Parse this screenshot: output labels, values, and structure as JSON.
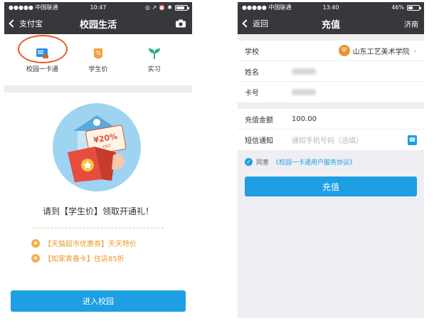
{
  "left": {
    "status": {
      "carrier": "●●●●● 中国联通",
      "time": "10:47",
      "right_icons": "◎ ↗ ⏰ ✱"
    },
    "nav": {
      "back_label": "支付宝",
      "title": "校园生活"
    },
    "quick_items": [
      {
        "label": "校园一卡通"
      },
      {
        "label": "学生价"
      },
      {
        "label": "实习"
      }
    ],
    "illustration": {
      "price_tag": "¥20%",
      "off": "OFF"
    },
    "headline": "请到【学生价】领取开通礼！",
    "offers": [
      {
        "text": "【天猫超市优惠券】天天特价"
      },
      {
        "text": "【如家青春卡】住店85折"
      }
    ],
    "enter_button": "进入校园"
  },
  "right": {
    "status": {
      "carrier": "●●●●● 中国联通",
      "time": "13:40",
      "battery": "46%"
    },
    "nav": {
      "back_label": "返回",
      "title": "充值",
      "city": "济南"
    },
    "rows_info": [
      {
        "label": "学校",
        "value": "山东工艺美术学院"
      },
      {
        "label": "姓名"
      },
      {
        "label": "卡号"
      }
    ],
    "amount": {
      "label": "充值金额",
      "value": "100.00"
    },
    "sms": {
      "label": "短信通知",
      "placeholder": "通知手机号码（选填）"
    },
    "agreement": {
      "prefix": "同意",
      "link": "《校园一卡通用户服务协议》"
    },
    "submit_button": "充值"
  },
  "colors": {
    "navbar": "#37373c",
    "accent": "#1e9fe4",
    "highlight_circle": "#e95a27",
    "offer": "#e99a2c"
  }
}
